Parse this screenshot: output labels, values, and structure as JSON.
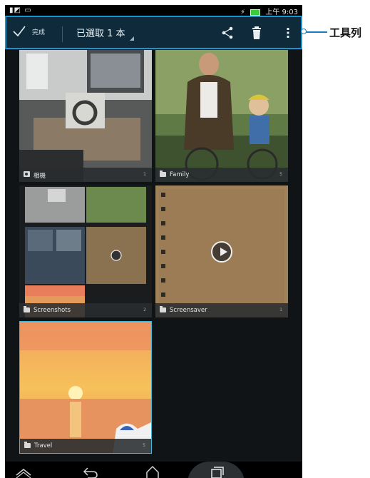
{
  "status_bar": {
    "left_icons": [
      "sim-icon",
      "image-icon"
    ],
    "time": "上午 9:03"
  },
  "toolbar": {
    "done_label": "完成",
    "selection_label": "已選取 1 本",
    "actions": [
      "share-icon",
      "delete-icon",
      "overflow-menu-icon"
    ]
  },
  "callout": {
    "label": "工具列"
  },
  "albums": [
    {
      "name": "相機",
      "count": "1",
      "icon": "camera-icon"
    },
    {
      "name": "Family",
      "count": "5",
      "icon": "folder-icon"
    },
    {
      "name": "Screenshots",
      "count": "2",
      "icon": "folder-icon"
    },
    {
      "name": "Screensaver",
      "count": "1",
      "icon": "folder-icon"
    },
    {
      "name": "Travel",
      "count": "5",
      "icon": "folder-icon",
      "selected": true
    }
  ],
  "accent_color": "#1a93cf"
}
